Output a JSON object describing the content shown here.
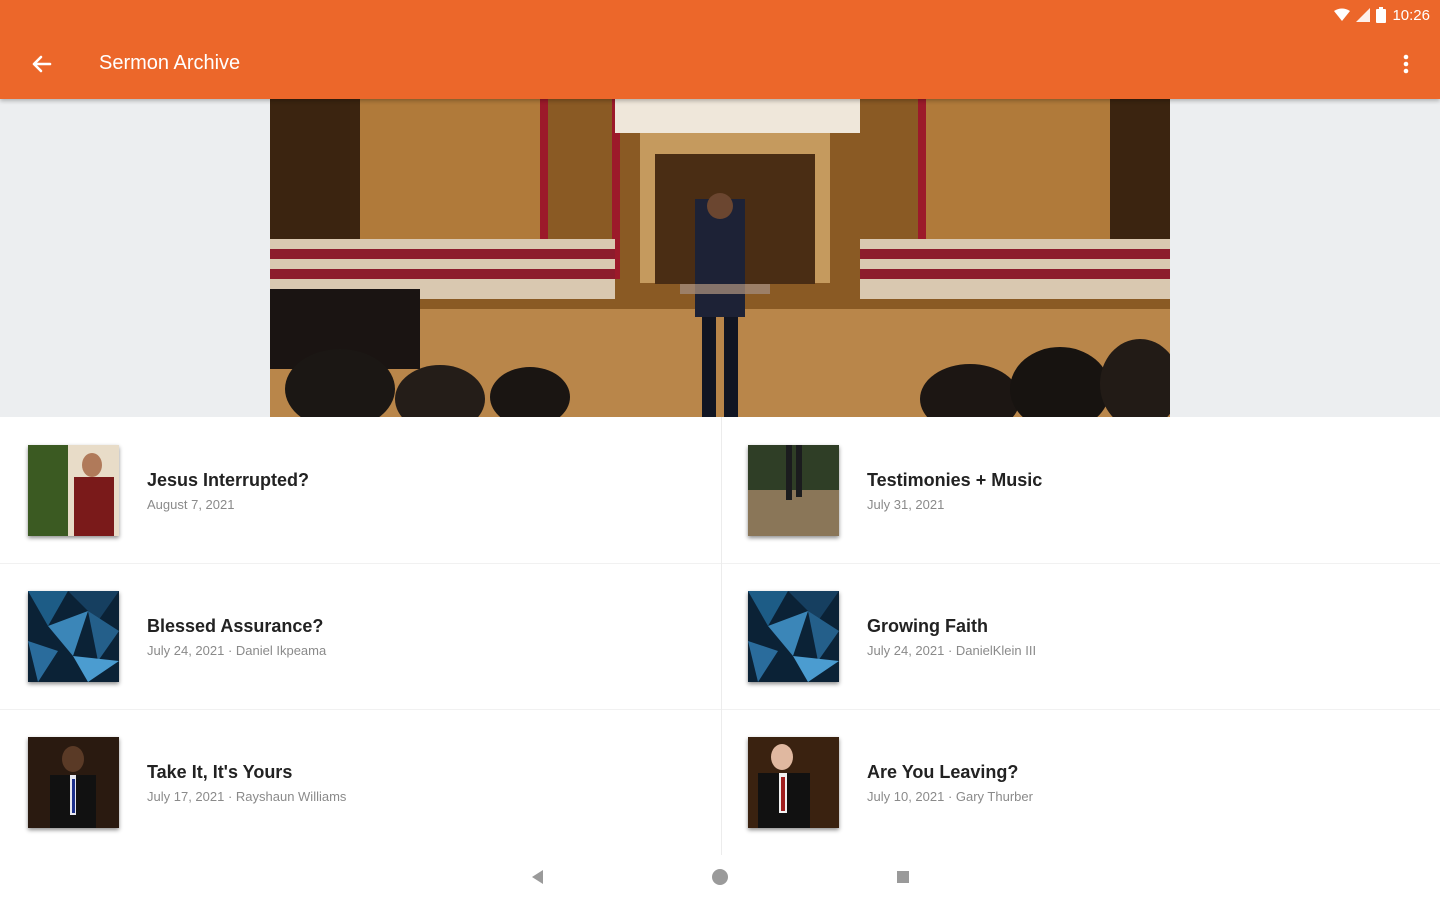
{
  "status_bar": {
    "time": "10:26"
  },
  "app_bar": {
    "title": "Sermon Archive"
  },
  "sermons": [
    {
      "title": "Jesus Interrupted?",
      "subtitle": "August 7, 2021"
    },
    {
      "title": "Testimonies + Music",
      "subtitle": "July 31, 2021"
    },
    {
      "title": "Blessed Assurance?",
      "subtitle": "July 24, 2021 · Daniel Ikpeama"
    },
    {
      "title": "Growing Faith",
      "subtitle": "July 24, 2021 · DanielKlein III"
    },
    {
      "title": "Take It, It's Yours",
      "subtitle": "July 17, 2021 · Rayshaun Williams"
    },
    {
      "title": "Are You Leaving?",
      "subtitle": "July 10, 2021 · Gary Thurber"
    }
  ],
  "colors": {
    "accent": "#ec672a"
  }
}
